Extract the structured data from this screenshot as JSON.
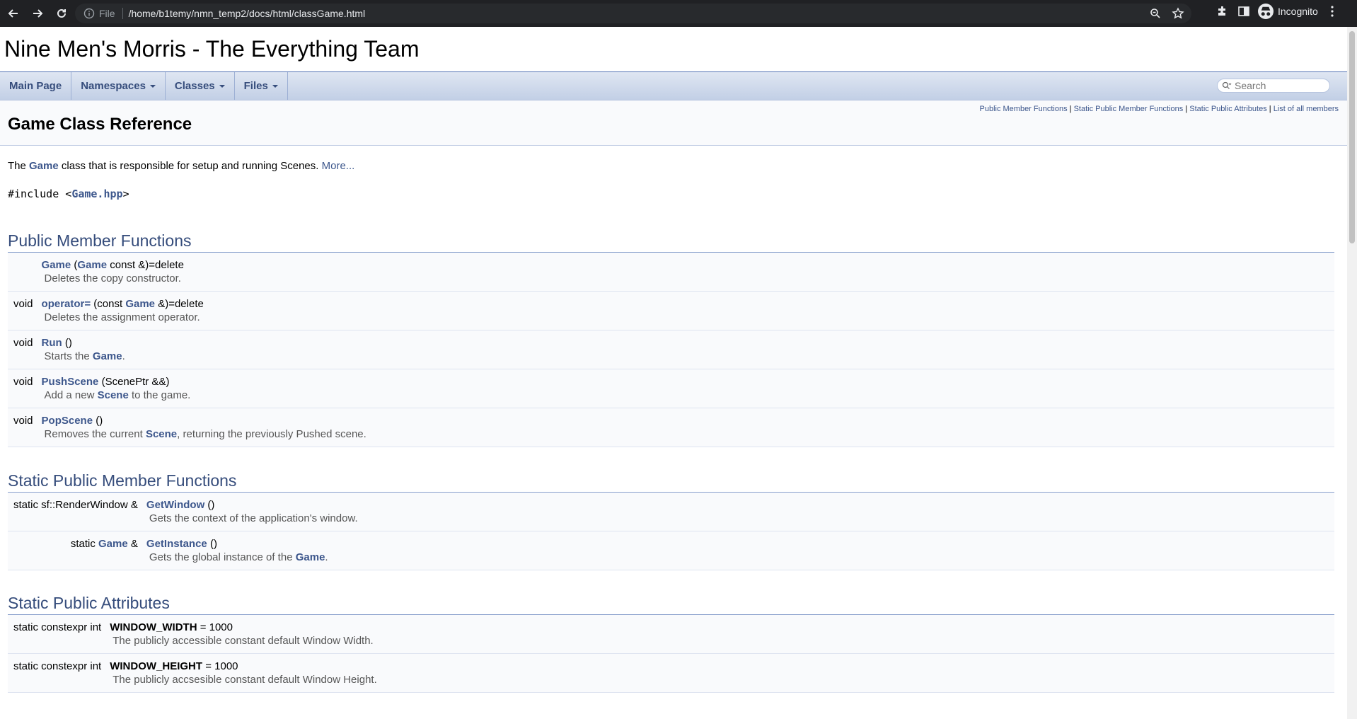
{
  "browser": {
    "file_label": "File",
    "url": "/home/b1temy/nmn_temp2/docs/html/classGame.html",
    "incognito_label": "Incognito"
  },
  "project": {
    "name": "Nine Men's Morris - The Everything Team"
  },
  "navbar": {
    "items": [
      {
        "label": "Main Page"
      },
      {
        "label": "Namespaces"
      },
      {
        "label": "Classes"
      },
      {
        "label": "Files"
      }
    ],
    "search_placeholder": "Search"
  },
  "header": {
    "summary_links": [
      "Public Member Functions",
      "Static Public Member Functions",
      "Static Public Attributes",
      "List of all members"
    ],
    "summary_sep": "|",
    "title": "Game Class Reference"
  },
  "brief": {
    "pre": "The ",
    "link": "Game",
    "post": " class that is responsible for setup and running Scenes. ",
    "more": "More..."
  },
  "include": {
    "pre": "#include <",
    "file": "Game.hpp",
    "post": ">"
  },
  "sections": {
    "public": "Public Member Functions",
    "static_functions": "Static Public Member Functions",
    "static_attributes": "Static Public Attributes"
  },
  "public_members": [
    {
      "ret": "",
      "name": "Game",
      "args_pre": " (",
      "args_link": "Game",
      "args_post": " const &)=delete",
      "desc_pre": "Deletes the copy constructor.",
      "desc_link": "",
      "desc_post": ""
    },
    {
      "ret": "void",
      "name": "operator=",
      "args_pre": " (const ",
      "args_link": "Game",
      "args_post": " &)=delete",
      "desc_pre": "Deletes the assignment operator.",
      "desc_link": "",
      "desc_post": ""
    },
    {
      "ret": "void",
      "name": "Run",
      "args_pre": " ()",
      "args_link": "",
      "args_post": "",
      "desc_pre": "Starts the ",
      "desc_link": "Game",
      "desc_post": "."
    },
    {
      "ret": "void",
      "name": "PushScene",
      "args_pre": " (ScenePtr &&)",
      "args_link": "",
      "args_post": "",
      "desc_pre": "Add a new ",
      "desc_link": "Scene",
      "desc_post": " to the game."
    },
    {
      "ret": "void",
      "name": "PopScene",
      "args_pre": " ()",
      "args_link": "",
      "args_post": "",
      "desc_pre": "Removes the current ",
      "desc_link": "Scene",
      "desc_post": ", returning the previously Pushed scene."
    }
  ],
  "static_functions": [
    {
      "ret_pre": "static sf::RenderWindow &",
      "ret_link": "",
      "ret_post": "",
      "name": "GetWindow",
      "args": " ()",
      "desc_pre": "Gets the context of the application's window.",
      "desc_link": "",
      "desc_post": ""
    },
    {
      "ret_pre": "static ",
      "ret_link": "Game",
      "ret_post": " &",
      "name": "GetInstance",
      "args": " ()",
      "desc_pre": "Gets the global instance of the ",
      "desc_link": "Game",
      "desc_post": "."
    }
  ],
  "static_attributes": [
    {
      "ret": "static constexpr int",
      "name": "WINDOW_WIDTH",
      "value": " = 1000",
      "desc": "The publicly accessible constant default Window Width."
    },
    {
      "ret": "static constexpr int",
      "name": "WINDOW_HEIGHT",
      "value": " = 1000",
      "desc": "The publicly accsesible constant default Window Height."
    }
  ]
}
